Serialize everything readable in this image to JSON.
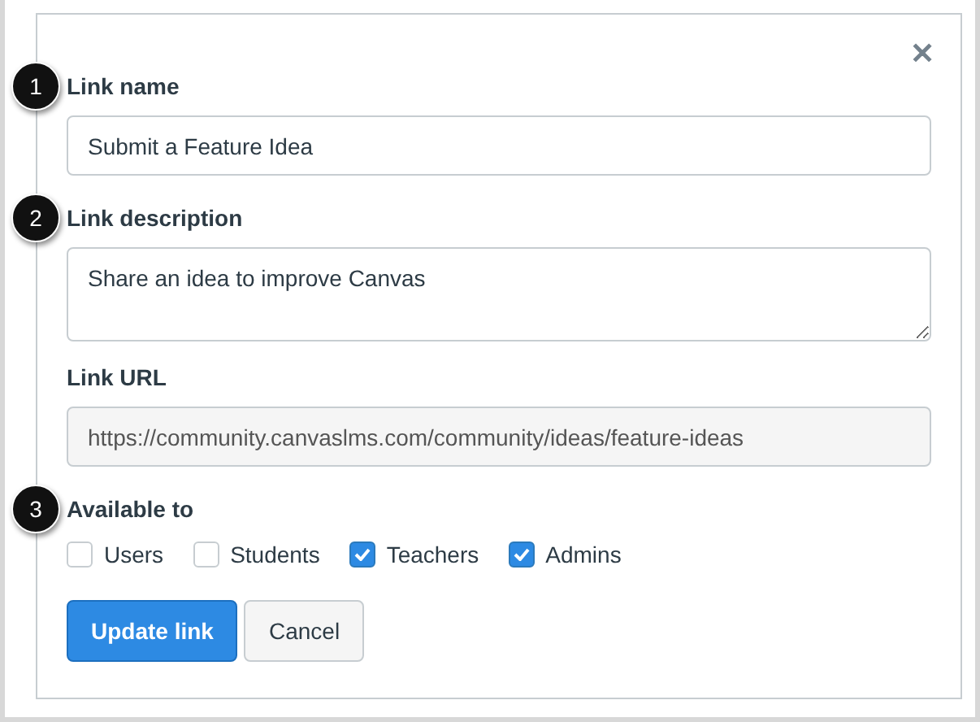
{
  "dialog": {
    "close": "✕"
  },
  "fields": [
    {
      "kind": "input",
      "label": "Link name",
      "callout": "1",
      "value": "Submit a Feature Idea"
    },
    {
      "kind": "textarea",
      "label": "Link description",
      "callout": "2",
      "value": "Share an idea to improve Canvas"
    },
    {
      "kind": "readonly",
      "label": "Link URL",
      "value": "https://community.canvaslms.com/community/ideas/feature-ideas"
    }
  ],
  "availability": {
    "label": "Available to",
    "callout": "3",
    "options": [
      {
        "label": "Users",
        "checked": false
      },
      {
        "label": "Students",
        "checked": false
      },
      {
        "label": "Teachers",
        "checked": true
      },
      {
        "label": "Admins",
        "checked": true
      }
    ]
  },
  "buttons": [
    {
      "label": "Update link",
      "kind": "primary"
    },
    {
      "label": "Cancel",
      "kind": "secondary"
    }
  ]
}
